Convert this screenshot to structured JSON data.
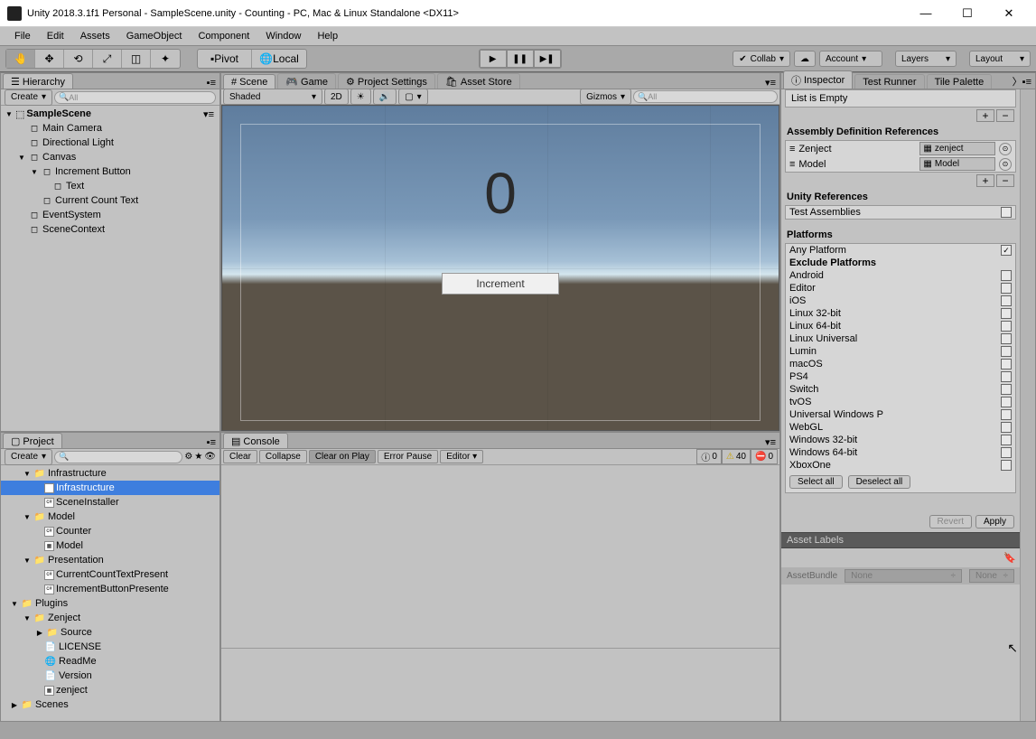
{
  "title": "Unity 2018.3.1f1 Personal - SampleScene.unity - Counting - PC, Mac & Linux Standalone <DX11>",
  "menus": [
    "File",
    "Edit",
    "Assets",
    "GameObject",
    "Component",
    "Window",
    "Help"
  ],
  "toolbar": {
    "pivot": "Pivot",
    "local": "Local",
    "collab": "Collab",
    "account": "Account",
    "layers": "Layers",
    "layout": "Layout"
  },
  "hierarchy": {
    "tab": "Hierarchy",
    "create": "Create",
    "search_placeholder": "All",
    "scene": "SampleScene",
    "items": [
      "Main Camera",
      "Directional Light",
      "Canvas",
      "Increment Button",
      "Text",
      "Current Count Text",
      "EventSystem",
      "SceneContext"
    ]
  },
  "scene": {
    "tabs": [
      "Scene",
      "Game",
      "Project Settings",
      "Asset Store"
    ],
    "shading": "Shaded",
    "mode2d": "2D",
    "gizmos": "Gizmos",
    "search_placeholder": "All",
    "big_number": "0",
    "button_label": "Increment"
  },
  "console": {
    "tab": "Console",
    "buttons": {
      "clear": "Clear",
      "collapse": "Collapse",
      "clear_on_play": "Clear on Play",
      "error_pause": "Error Pause",
      "editor": "Editor"
    },
    "counts": {
      "info": "0",
      "warn": "40",
      "err": "0"
    }
  },
  "project": {
    "tab": "Project",
    "create": "Create",
    "tree": {
      "infrastructure": "Infrastructure",
      "infrastructure_asset": "Infrastructure",
      "scene_installer": "SceneInstaller",
      "model": "Model",
      "counter": "Counter",
      "model_asset": "Model",
      "presentation": "Presentation",
      "current_count": "CurrentCountTextPresent",
      "increment_btn": "IncrementButtonPresente",
      "plugins": "Plugins",
      "zenject": "Zenject",
      "source": "Source",
      "license": "LICENSE",
      "readme": "ReadMe",
      "version": "Version",
      "zenject_asset": "zenject",
      "scenes": "Scenes"
    }
  },
  "inspector": {
    "tabs": [
      "Inspector",
      "Test Runner",
      "Tile Palette"
    ],
    "list_empty": "List is Empty",
    "asm_ref_header": "Assembly Definition References",
    "refs": [
      {
        "name": "Zenject",
        "target": "zenject"
      },
      {
        "name": "Model",
        "target": "Model"
      }
    ],
    "unity_refs": "Unity References",
    "test_assemblies": "Test Assemblies",
    "platforms": "Platforms",
    "any_platform": "Any Platform",
    "exclude": "Exclude Platforms",
    "platform_list": [
      "Android",
      "Editor",
      "iOS",
      "Linux 32-bit",
      "Linux 64-bit",
      "Linux Universal",
      "Lumin",
      "macOS",
      "PS4",
      "Switch",
      "tvOS",
      "Universal Windows P",
      "WebGL",
      "Windows 32-bit",
      "Windows 64-bit",
      "XboxOne"
    ],
    "select_all": "Select all",
    "deselect_all": "Deselect all",
    "revert": "Revert",
    "apply": "Apply",
    "asset_labels": "Asset Labels",
    "asset_bundle": "AssetBundle",
    "none": "None"
  }
}
